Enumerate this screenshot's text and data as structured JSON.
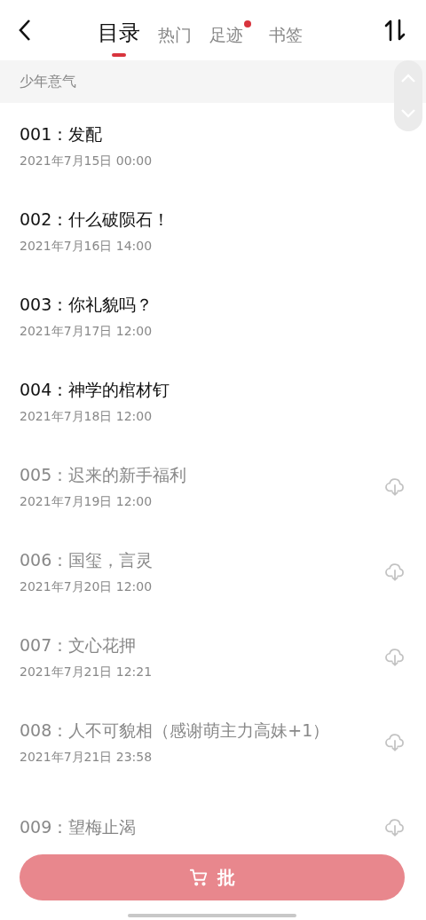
{
  "tabs": [
    {
      "label": "目录",
      "selected": true,
      "dot": false
    },
    {
      "label": "热门",
      "selected": false,
      "dot": false
    },
    {
      "label": "足迹",
      "selected": false,
      "dot": true
    },
    {
      "label": "书签",
      "selected": false,
      "dot": false
    }
  ],
  "section": {
    "title": "少年意气"
  },
  "chapters": [
    {
      "title": "001：发配",
      "date": "2021年7月15日 00:00",
      "downloaded": true
    },
    {
      "title": "002：什么破陨石！",
      "date": "2021年7月16日 14:00",
      "downloaded": true
    },
    {
      "title": "003：你礼貌吗？",
      "date": "2021年7月17日 12:00",
      "downloaded": true
    },
    {
      "title": "004：神学的棺材钉",
      "date": "2021年7月18日 12:00",
      "downloaded": true
    },
    {
      "title": "005：迟来的新手福利",
      "date": "2021年7月19日 12:00",
      "downloaded": false
    },
    {
      "title": "006：国玺，言灵",
      "date": "2021年7月20日 12:00",
      "downloaded": false
    },
    {
      "title": "007：文心花押",
      "date": "2021年7月21日 12:21",
      "downloaded": false
    },
    {
      "title": "008：人不可貌相（感谢萌主力高妹+1）",
      "date": "2021年7月21日 23:58",
      "downloaded": false
    },
    {
      "title": "009：望梅止渴",
      "downloaded": false
    }
  ],
  "buy_button": {
    "label": "批"
  }
}
